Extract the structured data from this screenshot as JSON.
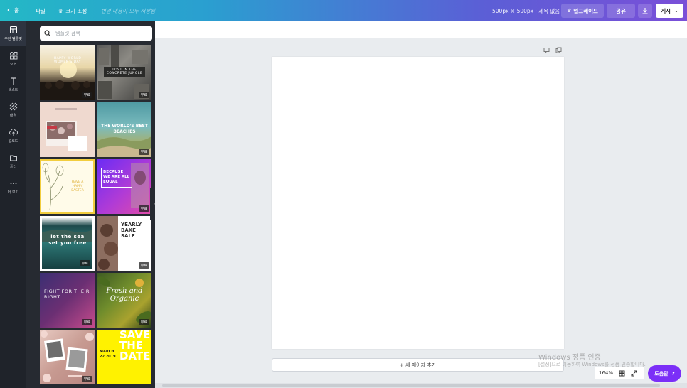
{
  "topbar": {
    "home_label": "홈",
    "file_label": "파일",
    "resize_label": "크기 조정",
    "saved_status": "변경 내용이 모두 저장됨",
    "dimensions": "500px × 500px · 제목 없음",
    "upgrade_label": "업그레이드",
    "share_label": "공유",
    "publish_label": "게시"
  },
  "rail": {
    "items": [
      {
        "label": "추천 템플릿",
        "icon": "template-icon"
      },
      {
        "label": "요소",
        "icon": "elements-icon"
      },
      {
        "label": "텍스트",
        "icon": "text-icon"
      },
      {
        "label": "배경",
        "icon": "background-icon"
      },
      {
        "label": "업로드",
        "icon": "upload-icon"
      },
      {
        "label": "폴더",
        "icon": "folder-icon"
      },
      {
        "label": "더 보기",
        "icon": "more-icon"
      }
    ]
  },
  "panel": {
    "search_placeholder": "템플릿 검색",
    "free_badge": "무료",
    "templates": [
      {
        "title": "HAPPY WORLD WOMEN'S DAY"
      },
      {
        "title": "LOST IN THE CONCRETE JUNGLE"
      },
      {
        "title": ""
      },
      {
        "title": "THE WORLD'S BEST BEACHES"
      },
      {
        "title": "HAVE A HAPPY EASTER"
      },
      {
        "title": "BECAUSE WE ARE ALL EQUAL"
      },
      {
        "title": "let the sea set you free"
      },
      {
        "title": "YEARLY BAKE SALE"
      },
      {
        "title": "FIGHT FOR THEIR RIGHT"
      },
      {
        "title": "Fresh and Organic"
      },
      {
        "title": ""
      },
      {
        "title": "SAVE THE DATE",
        "subtitle": "MARCH 22 2019"
      }
    ]
  },
  "canvas": {
    "add_page_label": "+ 새 페이지 추가",
    "zoom": "164%"
  },
  "watermark": {
    "line1": "Windows 정품 인증",
    "line2": "[설정]으로 이동하여 Windows를 정품 인증합니다."
  },
  "help_label": "도움말",
  "help_symbol": "?"
}
